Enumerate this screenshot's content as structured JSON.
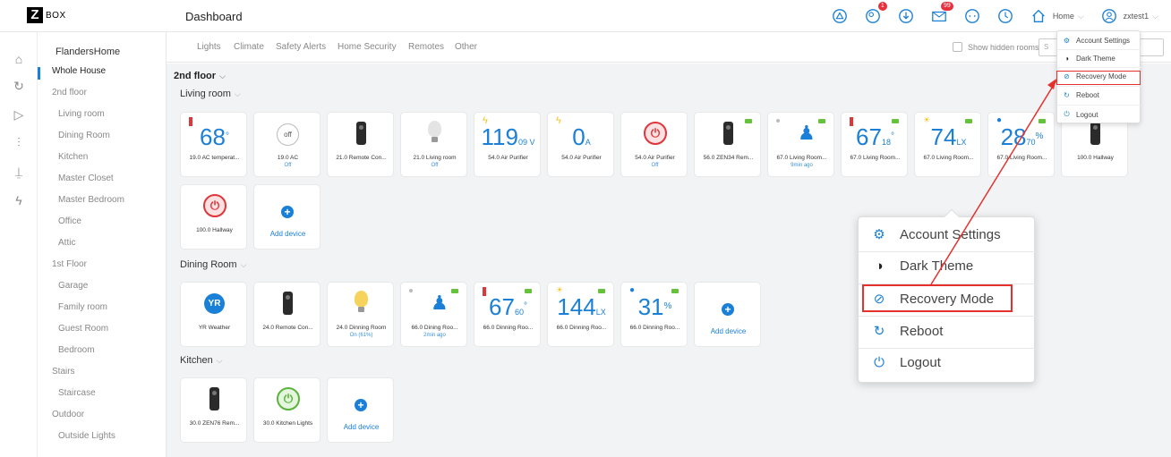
{
  "app": {
    "logo_letter": "Z",
    "logo_text": "BOX",
    "page_title": "Dashboard"
  },
  "header": {
    "notif_badge": "99",
    "users_badge": "1",
    "home_label": "Home",
    "user_label": "zxtest1"
  },
  "sidebar": {
    "home_name": "FlandersHome",
    "items": [
      {
        "label": "Whole House",
        "level": 0,
        "active": true
      },
      {
        "label": "2nd floor",
        "level": 0
      },
      {
        "label": "Living room",
        "level": 1
      },
      {
        "label": "Dining Room",
        "level": 1
      },
      {
        "label": "Kitchen",
        "level": 1
      },
      {
        "label": "Master Closet",
        "level": 1
      },
      {
        "label": "Master Bedroom",
        "level": 1
      },
      {
        "label": "Office",
        "level": 1
      },
      {
        "label": "Attic",
        "level": 1
      },
      {
        "label": "1st Floor",
        "level": 0
      },
      {
        "label": "Garage",
        "level": 1
      },
      {
        "label": "Family room",
        "level": 1
      },
      {
        "label": "Guest Room",
        "level": 1
      },
      {
        "label": "Bedroom",
        "level": 1
      },
      {
        "label": "Stairs",
        "level": 0
      },
      {
        "label": "Staircase",
        "level": 1
      },
      {
        "label": "Outdoor",
        "level": 0
      },
      {
        "label": "Outside Lights",
        "level": 1
      }
    ]
  },
  "tabs": [
    "Lights",
    "Climate",
    "Safety Alerts",
    "Home Security",
    "Remotes",
    "Other"
  ],
  "filters": {
    "show_hidden": "Show hidden rooms",
    "search_placeholder": "S"
  },
  "floor": "2nd floor",
  "rooms": {
    "living": {
      "title": "Living room",
      "cards": [
        {
          "label": "19.0 AC temperat...",
          "value": "68",
          "unit": "°"
        },
        {
          "label": "19.0 AC",
          "status": "Off",
          "button": "off"
        },
        {
          "label": "21.0 Remote Con..."
        },
        {
          "label": "21.0 Living room",
          "status": "Off"
        },
        {
          "label": "54.0 Air Purifier",
          "value": "119",
          "unit": "09 V"
        },
        {
          "label": "54.0 Air Purifier",
          "value": "0",
          "unit": "A"
        },
        {
          "label": "54.0 Air Purifier",
          "status": "Off"
        },
        {
          "label": "56.0 ZEN34 Rem..."
        },
        {
          "label": "67.0 Living Room...",
          "status": "9min ago"
        },
        {
          "label": "67.0 Living Room...",
          "value": "67",
          "unit": "18"
        },
        {
          "label": "67.0 Living Room...",
          "value": "74",
          "unit": "LX"
        },
        {
          "label": "67.0 Living Room...",
          "value": "28",
          "unit": "70",
          "sup": "%"
        },
        {
          "label": "100.0 Hallway"
        }
      ],
      "row2": [
        {
          "label": "100.0 Hallway"
        },
        {
          "add_label": "Add device"
        }
      ]
    },
    "dining": {
      "title": "Dining Room",
      "cards": [
        {
          "label": "YR Weather",
          "icon_text": "YR"
        },
        {
          "label": "24.0 Remote Con..."
        },
        {
          "label": "24.0 Dinning Room",
          "status": "On (61%)"
        },
        {
          "label": "66.0 Dining Roo...",
          "status": "2min ago"
        },
        {
          "label": "66.0 Dinning Roo...",
          "value": "67",
          "unit": "60"
        },
        {
          "label": "66.0 Dinning Roo...",
          "value": "144",
          "unit": "LX"
        },
        {
          "label": "66.0 Dinning Roo...",
          "value": "31",
          "sup": "%"
        },
        {
          "add_label": "Add device"
        }
      ]
    },
    "kitchen": {
      "title": "Kitchen",
      "cards": [
        {
          "label": "30.0 ZEN76 Rem..."
        },
        {
          "label": "30.0 Kitchen Lights"
        },
        {
          "add_label": "Add device"
        }
      ]
    }
  },
  "user_menu": {
    "items": [
      "Account Settings",
      "Dark Theme",
      "Recovery Mode",
      "Reboot",
      "Logout"
    ],
    "highlighted": "Recovery Mode"
  },
  "colors": {
    "accent": "#1a7fd6",
    "annotation": "#e5312d",
    "power_off": "#e0353a",
    "power_on": "#5bb33d"
  }
}
